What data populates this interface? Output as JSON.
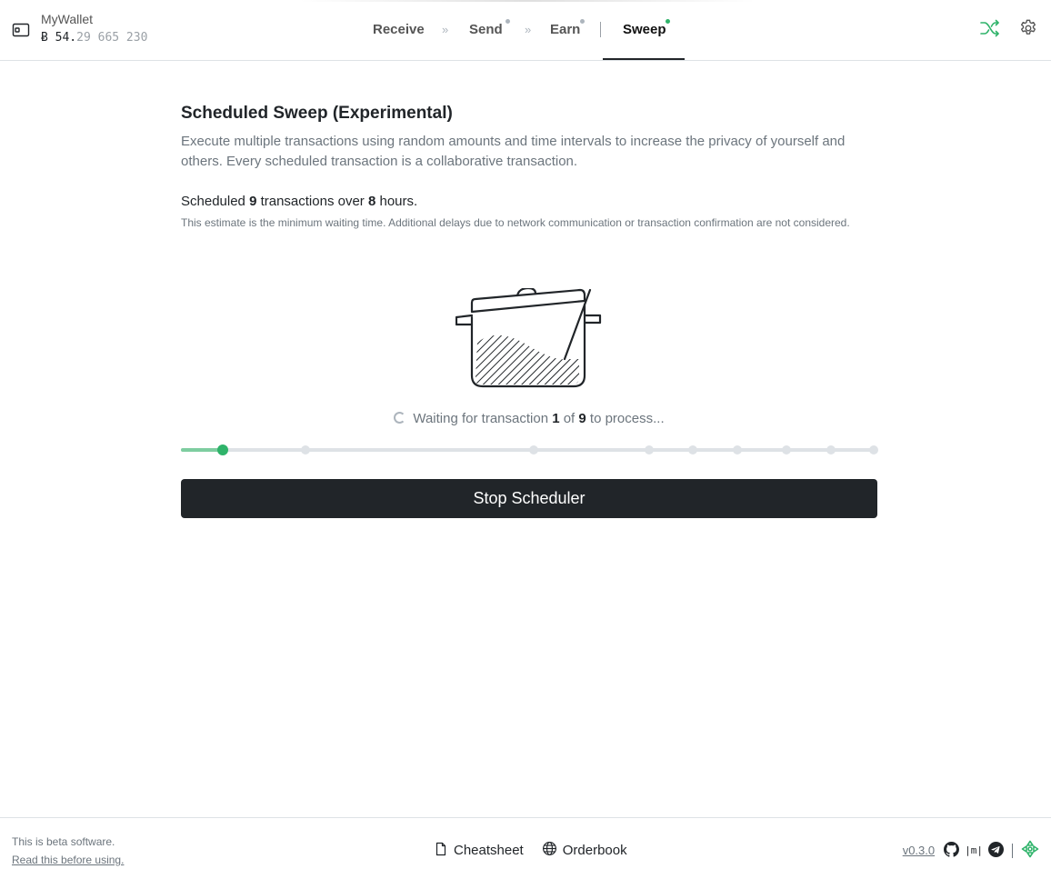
{
  "header": {
    "wallet_name": "MyWallet",
    "balance_symbol": "Ƀ",
    "balance_int": "54.",
    "balance_frac": "29 665 230",
    "nav": {
      "receive": "Receive",
      "send": "Send",
      "earn": "Earn",
      "sweep": "Sweep",
      "separator": "»"
    },
    "active_tab": "Sweep",
    "icons": {
      "wallet": "wallet-icon",
      "jam": "shuffle-icon",
      "settings": "gear-icon"
    },
    "colors": {
      "accent_green": "#2fb36a",
      "dot_grey": "#adb5bd"
    }
  },
  "main": {
    "title": "Scheduled Sweep (Experimental)",
    "description": "Execute multiple transactions using random amounts and time intervals to increase the privacy of yourself and others. Every scheduled transaction is a collaborative transaction.",
    "summary_prefix": "Scheduled ",
    "summary_count": "9",
    "summary_mid": " transactions over ",
    "summary_hours": "8",
    "summary_suffix": " hours.",
    "note": "This estimate is the minimum waiting time. Additional delays due to network communication or transaction confirmation are not considered.",
    "waiting_prefix": "Waiting for transaction ",
    "waiting_current": "1",
    "waiting_mid": " of ",
    "waiting_total": "9",
    "waiting_suffix": " to process...",
    "progress": {
      "fraction": 0.06,
      "ticks": [
        0.06,
        0.179,
        0.506,
        0.672,
        0.735,
        0.799,
        0.869,
        0.933,
        0.995
      ],
      "current_tick": 0
    },
    "stop_button": "Stop Scheduler"
  },
  "footer": {
    "beta_text": "This is beta software.",
    "beta_link": "Read this before using.",
    "cheatsheet": "Cheatsheet",
    "orderbook": "Orderbook",
    "version": "v0.3.0",
    "matrix_glyph": "|m|",
    "icons": [
      "github-icon",
      "matrix-icon",
      "telegram-icon",
      "jam-logo-icon"
    ]
  }
}
